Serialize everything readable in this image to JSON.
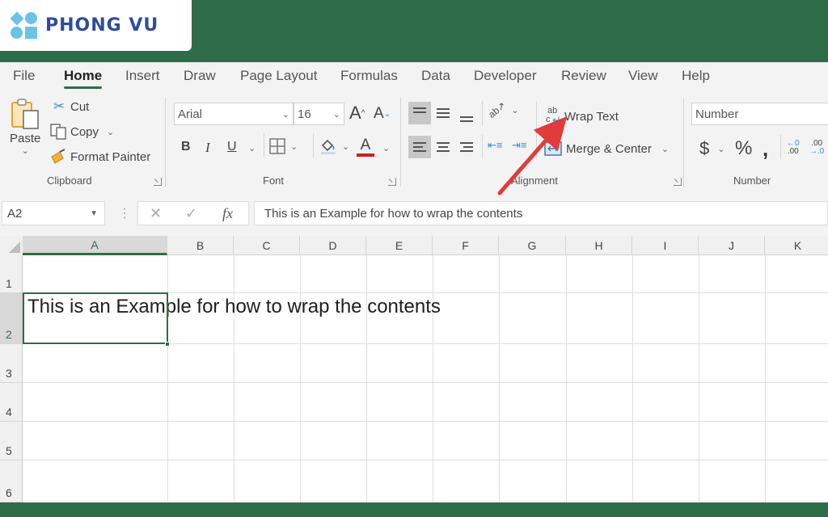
{
  "brand": {
    "name": "PHONG VU",
    "logo_icon": "phongvu-logo-icon"
  },
  "colors": {
    "brand_green": "#2e6d48",
    "brand_blue": "#2f4c9a",
    "logo_cyan": "#6ac3e6",
    "annotation_arrow": "#e03c3c",
    "font_color_bar": "#cc1f1f"
  },
  "tabs": [
    {
      "label": "File",
      "active": false
    },
    {
      "label": "Home",
      "active": true
    },
    {
      "label": "Insert",
      "active": false
    },
    {
      "label": "Draw",
      "active": false
    },
    {
      "label": "Page Layout",
      "active": false
    },
    {
      "label": "Formulas",
      "active": false
    },
    {
      "label": "Data",
      "active": false
    },
    {
      "label": "Developer",
      "active": false
    },
    {
      "label": "Review",
      "active": false
    },
    {
      "label": "View",
      "active": false
    },
    {
      "label": "Help",
      "active": false
    }
  ],
  "ribbon": {
    "clipboard": {
      "label": "Clipboard",
      "paste": "Paste",
      "cut": "Cut",
      "copy": "Copy",
      "format_painter": "Format Painter"
    },
    "font": {
      "label": "Font",
      "font_name": "Arial",
      "font_size": "16",
      "bold": "B",
      "italic": "I",
      "underline": "U",
      "increase_font": "A",
      "decrease_font": "A",
      "font_color_glyph": "A"
    },
    "alignment": {
      "label": "Alignment",
      "wrap_text": "Wrap Text",
      "merge_center": "Merge & Center"
    },
    "number": {
      "label": "Number",
      "format": "Number",
      "currency": "$",
      "percent": "%",
      "comma": "’"
    }
  },
  "formula_bar": {
    "name_box": "A2",
    "cancel": "✕",
    "enter": "✓",
    "fx": "fx",
    "content": "This is an Example for how to wrap the contents"
  },
  "sheet": {
    "columns": [
      "A",
      "B",
      "C",
      "D",
      "E",
      "F",
      "G",
      "H",
      "I",
      "J",
      "K"
    ],
    "rows": [
      "1",
      "2",
      "3",
      "4",
      "5",
      "6"
    ],
    "selected_cell": "A2",
    "cells": {
      "A2": "This is an Example for how to wrap the contents"
    }
  }
}
